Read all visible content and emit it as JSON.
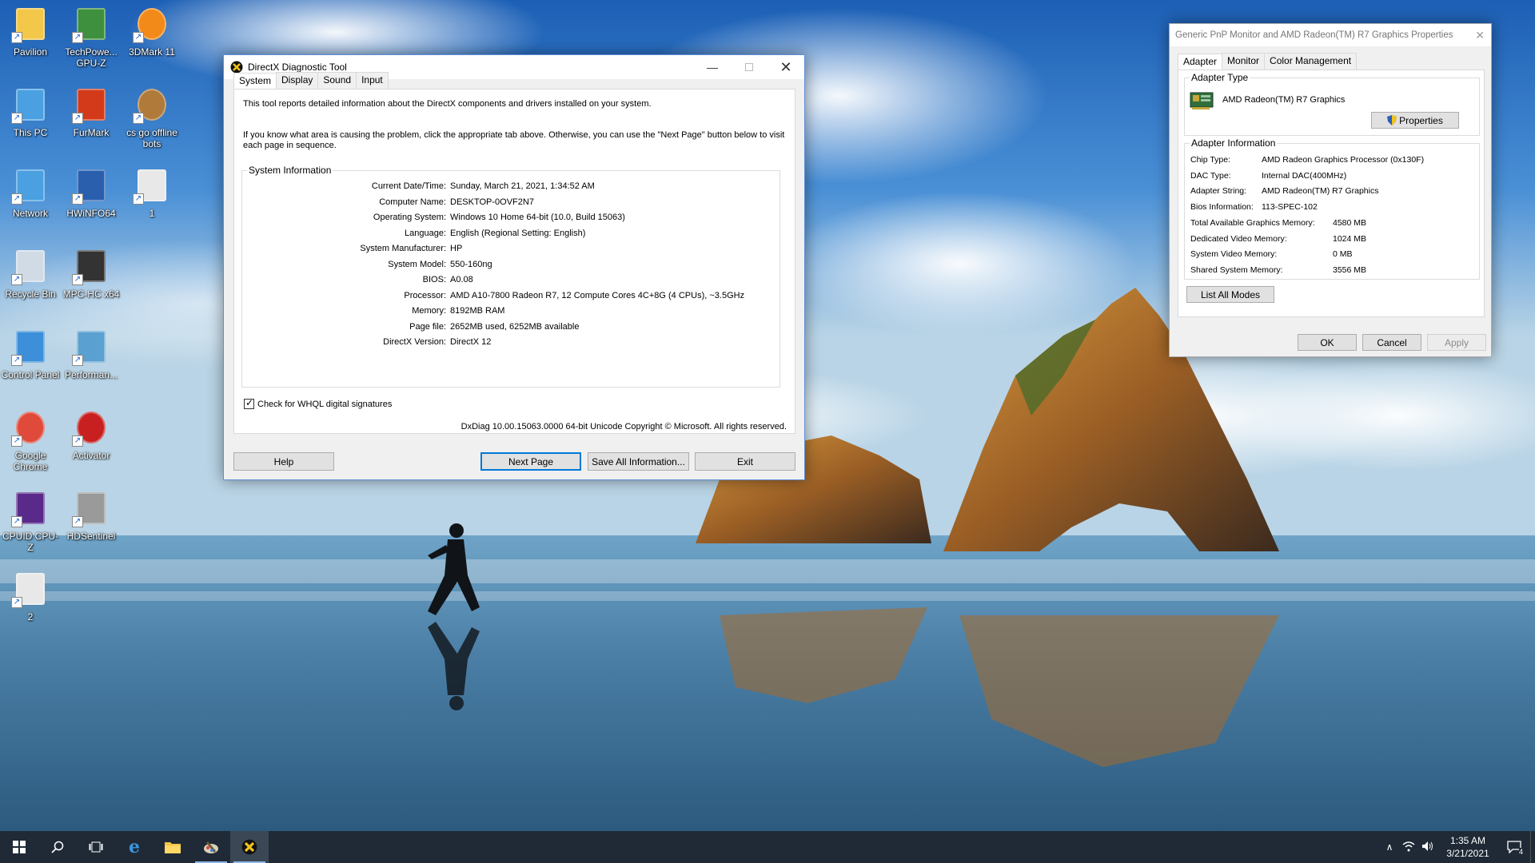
{
  "desktop_icons": [
    {
      "label": "Pavilion",
      "icon": "folder-user-icon"
    },
    {
      "label": "TechPowe...\nGPU-Z",
      "icon": "gpu-z-icon"
    },
    {
      "label": "3DMark 11",
      "icon": "3dmark-icon"
    },
    {
      "label": "This PC",
      "icon": "computer-icon"
    },
    {
      "label": "FurMark",
      "icon": "furmark-icon"
    },
    {
      "label": "cs go offline\nbots",
      "icon": "csgo-icon"
    },
    {
      "label": "Network",
      "icon": "network-icon"
    },
    {
      "label": "HWiNFO64",
      "icon": "hwinfo-icon"
    },
    {
      "label": "1",
      "icon": "image-file-icon"
    },
    {
      "label": "Recycle Bin",
      "icon": "recycle-bin-icon"
    },
    {
      "label": "MPC-HC x64",
      "icon": "mpc-hc-icon"
    },
    {
      "label": "Control Panel",
      "icon": "control-panel-icon"
    },
    {
      "label": "Performan...",
      "icon": "performance-icon"
    },
    {
      "label": "Google\nChrome",
      "icon": "chrome-icon"
    },
    {
      "label": "Activator",
      "icon": "activator-icon"
    },
    {
      "label": "CPUID CPU-Z",
      "icon": "cpu-z-icon"
    },
    {
      "label": "HDSentinel",
      "icon": "hdsentinel-icon"
    },
    {
      "label": "2",
      "icon": "image-file-icon"
    }
  ],
  "dxdiag": {
    "title": "DirectX Diagnostic Tool",
    "tabs": [
      "System",
      "Display",
      "Sound",
      "Input"
    ],
    "active_tab": "System",
    "intro1": "This tool reports detailed information about the DirectX components and drivers installed on your system.",
    "intro2": "If you know what area is causing the problem, click the appropriate tab above.  Otherwise, you can use the \"Next Page\" button below to visit each page in sequence.",
    "group_title": "System Information",
    "system_info": [
      {
        "label": "Current Date/Time:",
        "value": "Sunday, March 21, 2021, 1:34:52 AM"
      },
      {
        "label": "Computer Name:",
        "value": "DESKTOP-0OVF2N7"
      },
      {
        "label": "Operating System:",
        "value": "Windows 10 Home 64-bit (10.0, Build 15063)"
      },
      {
        "label": "Language:",
        "value": "English (Regional Setting: English)"
      },
      {
        "label": "System Manufacturer:",
        "value": "HP"
      },
      {
        "label": "System Model:",
        "value": "550-160ng"
      },
      {
        "label": "BIOS:",
        "value": "A0.08"
      },
      {
        "label": "Processor:",
        "value": "AMD A10-7800 Radeon R7, 12 Compute Cores 4C+8G  (4 CPUs), ~3.5GHz"
      },
      {
        "label": "Memory:",
        "value": "8192MB RAM"
      },
      {
        "label": "Page file:",
        "value": "2652MB used, 6252MB available"
      },
      {
        "label": "DirectX Version:",
        "value": "DirectX 12"
      }
    ],
    "whql_label": "Check for WHQL digital signatures",
    "whql_checked": true,
    "copyright": "DxDiag 10.00.15063.0000 64-bit Unicode  Copyright © Microsoft. All rights reserved.",
    "buttons": {
      "help": "Help",
      "next": "Next Page",
      "save": "Save All Information...",
      "exit": "Exit"
    }
  },
  "display_props": {
    "title": "Generic PnP Monitor and AMD Radeon(TM) R7 Graphics Properties",
    "tabs": [
      "Adapter",
      "Monitor",
      "Color Management"
    ],
    "active_tab": "Adapter",
    "adapter_type_title": "Adapter Type",
    "adapter_name": "AMD Radeon(TM) R7 Graphics",
    "properties_button": "Properties",
    "adapter_info_title": "Adapter Information",
    "adapter_info": [
      {
        "label": "Chip Type:",
        "value": "AMD Radeon Graphics Processor (0x130F)"
      },
      {
        "label": "DAC Type:",
        "value": "Internal DAC(400MHz)"
      },
      {
        "label": "Adapter String:",
        "value": "AMD Radeon(TM) R7 Graphics"
      },
      {
        "label": "Bios Information:",
        "value": "113-SPEC-102"
      }
    ],
    "memory_info": [
      {
        "label": "Total Available Graphics Memory:",
        "value": "4580 MB"
      },
      {
        "label": "Dedicated Video Memory:",
        "value": "1024 MB"
      },
      {
        "label": "System Video Memory:",
        "value": "0 MB"
      },
      {
        "label": "Shared System Memory:",
        "value": "3556 MB"
      }
    ],
    "list_modes_button": "List All Modes",
    "ok": "OK",
    "cancel": "Cancel",
    "apply": "Apply"
  },
  "taskbar": {
    "time": "1:35 AM",
    "date": "3/21/2021",
    "notification_count": "4"
  },
  "colors": {
    "accent": "#0078d7",
    "taskbar": "#1f2a36",
    "window_border": "#5c8ed8"
  }
}
